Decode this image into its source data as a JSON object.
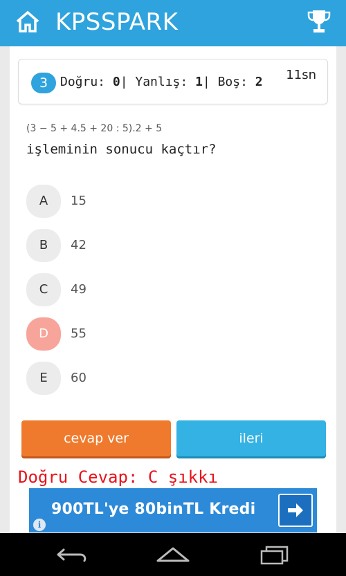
{
  "app_bar": {
    "title": "KPSSPARK",
    "home_icon": "home-icon",
    "trophy_icon": "trophy-icon",
    "color": "#2ea3dd"
  },
  "score": {
    "question_number": "3",
    "correct_label": "Doğru: ",
    "correct_value": "0",
    "wrong_label": "| Yanlış: ",
    "wrong_value": "1",
    "empty_label": "| Boş: ",
    "empty_value": "2",
    "timer": "11sn"
  },
  "question": {
    "expression": "(3 − 5 + 4.5 + 20 : 5).2 + 5",
    "text": "işleminin sonucu kaçtır?"
  },
  "options": [
    {
      "letter": "A",
      "value": "15",
      "state": "default"
    },
    {
      "letter": "B",
      "value": "42",
      "state": "default"
    },
    {
      "letter": "C",
      "value": "49",
      "state": "default"
    },
    {
      "letter": "D",
      "value": "55",
      "state": "wrong"
    },
    {
      "letter": "E",
      "value": "60",
      "state": "default"
    }
  ],
  "buttons": {
    "answer": "cevap ver",
    "next": "ileri",
    "answer_color": "#ef7a2d",
    "next_color": "#33b2e3"
  },
  "feedback": {
    "correct_answer": "Doğru Cevap: C şıkkı",
    "color": "#e8131b"
  },
  "ad": {
    "text": "900TL'ye 80binTL Kredi",
    "info_icon": "info-icon",
    "arrow_icon": "arrow-right-icon",
    "info_glyph": "i"
  },
  "nav": {
    "back_icon": "back-icon",
    "home_icon": "home-nav-icon",
    "recents_icon": "recents-icon"
  }
}
